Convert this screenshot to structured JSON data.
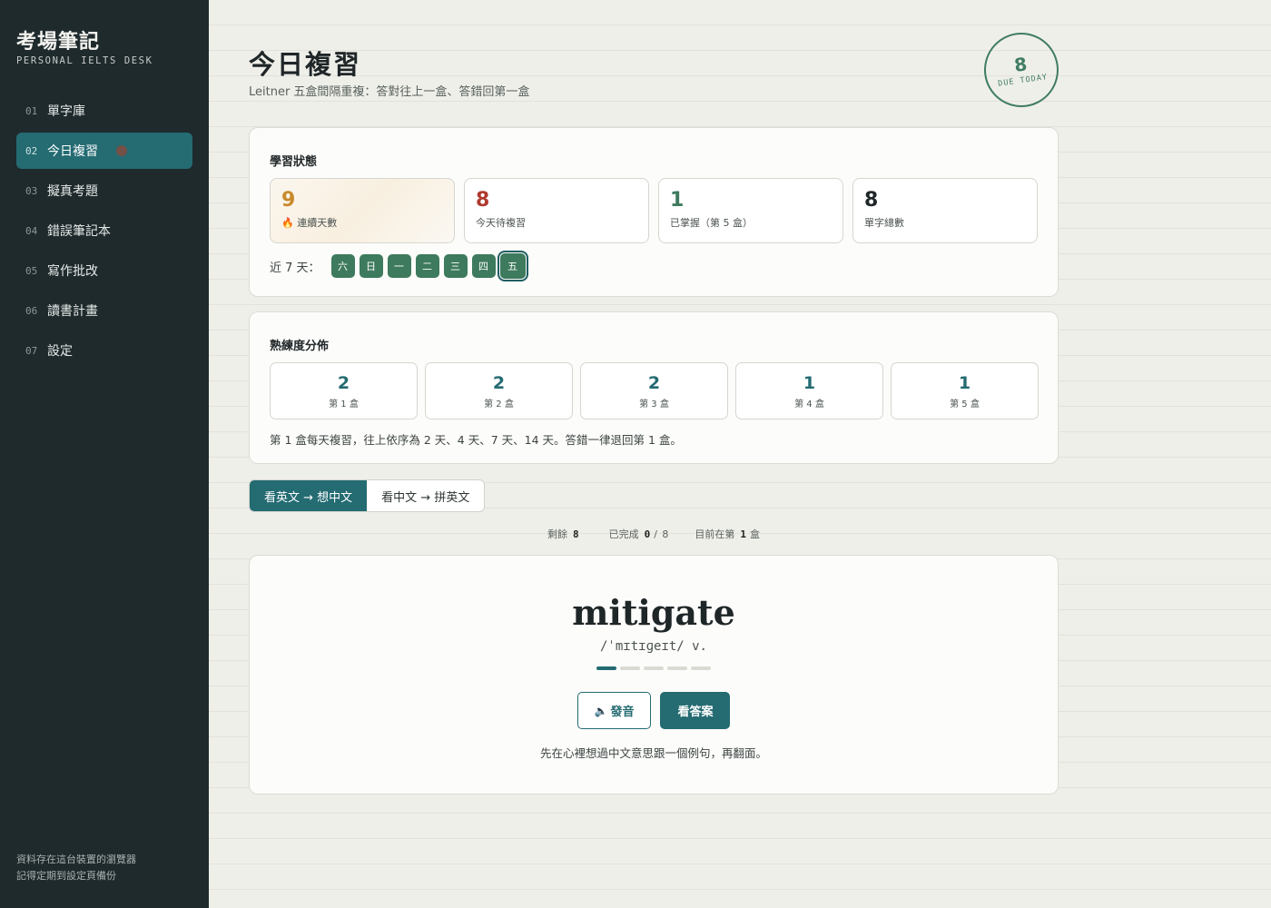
{
  "app": {
    "title": "考場筆記",
    "subtitle": "PERSONAL IELTS DESK"
  },
  "sidebar": {
    "items": [
      {
        "num": "01",
        "label": "單字庫"
      },
      {
        "num": "02",
        "label": "今日複習"
      },
      {
        "num": "03",
        "label": "擬真考題"
      },
      {
        "num": "04",
        "label": "錯誤筆記本"
      },
      {
        "num": "05",
        "label": "寫作批改"
      },
      {
        "num": "06",
        "label": "讀書計畫"
      },
      {
        "num": "07",
        "label": "設定"
      }
    ],
    "footer": [
      "資料存在這台裝置的瀏覽器",
      "記得定期到設定頁備份"
    ]
  },
  "header": {
    "title": "今日複習",
    "subtitle": "Leitner 五盒間隔重複：答對往上一盒、答錯回第一盒",
    "due": {
      "count": "8",
      "label": "DUE TODAY"
    }
  },
  "status": {
    "heading": "學習狀態",
    "stats": [
      {
        "value": "9",
        "label": "🔥 連續天數",
        "color": "#c88a2b"
      },
      {
        "value": "8",
        "label": "今天待複習",
        "color": "#b0392e"
      },
      {
        "value": "1",
        "label": "已掌握（第 5 盒）",
        "color": "#3e7a5d"
      },
      {
        "value": "8",
        "label": "單字總數",
        "color": "#1f2628"
      }
    ],
    "streak_label": "近 7 天：",
    "days": [
      "六",
      "日",
      "一",
      "二",
      "三",
      "四",
      "五"
    ]
  },
  "distribution": {
    "heading": "熟練度分佈",
    "boxes": [
      {
        "value": "2",
        "label": "第 1 盒"
      },
      {
        "value": "2",
        "label": "第 2 盒"
      },
      {
        "value": "2",
        "label": "第 3 盒"
      },
      {
        "value": "1",
        "label": "第 4 盒"
      },
      {
        "value": "1",
        "label": "第 5 盒"
      }
    ],
    "note": "第 1 盒每天複習，往上依序為 2 天、4 天、7 天、14 天。答錯一律退回第 1 盒。"
  },
  "modes": {
    "active": "看英文 → 想中文",
    "other": "看中文 → 拼英文"
  },
  "progress": {
    "remaining_label": "剩餘",
    "remaining": "8",
    "done_label": "已完成",
    "done": "0",
    "total": "/ 8",
    "box_label_pre": "目前在第",
    "box": "1",
    "box_label_post": "盒"
  },
  "card": {
    "word": "mitigate",
    "phonetic": "/ˈmɪtɪɡeɪt/ v.",
    "level": 1,
    "level_max": 5,
    "speak_label": "發音",
    "reveal_label": "看答案",
    "hint": "先在心裡想過中文意思跟一個例句，再翻面。"
  },
  "colors": {
    "accent": "#246b72",
    "sidebar": "#1f2a2d",
    "green": "#3e7a5d"
  }
}
